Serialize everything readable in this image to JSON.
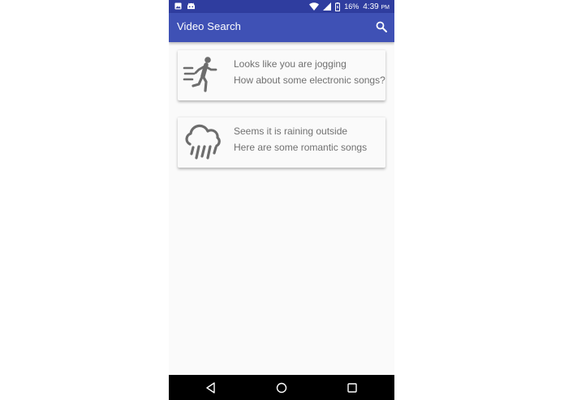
{
  "status_bar": {
    "battery_percent": "16%",
    "time": "4:39",
    "time_suffix": "PM",
    "icons": [
      "image-icon",
      "android-icon",
      "wifi-icon",
      "signal-icon",
      "battery-charging-icon"
    ]
  },
  "app_bar": {
    "title": "Video Search",
    "search_icon": "search-icon"
  },
  "cards": [
    {
      "icon": "running-person-icon",
      "line1": "Looks like you are jogging",
      "line2": "How about some electronic songs?"
    },
    {
      "icon": "rain-cloud-icon",
      "line1": "Seems it is raining outside",
      "line2": "Here are some romantic songs"
    }
  ],
  "nav_bar": {
    "icons": [
      "back-icon",
      "home-icon",
      "recents-icon"
    ]
  },
  "colors": {
    "status_bar": "#2f3d9f",
    "app_bar": "#3f51b5",
    "background": "#fafafa",
    "card_text": "#707070",
    "icon_gray": "#6d6d6d",
    "nav_bar": "#000000"
  }
}
